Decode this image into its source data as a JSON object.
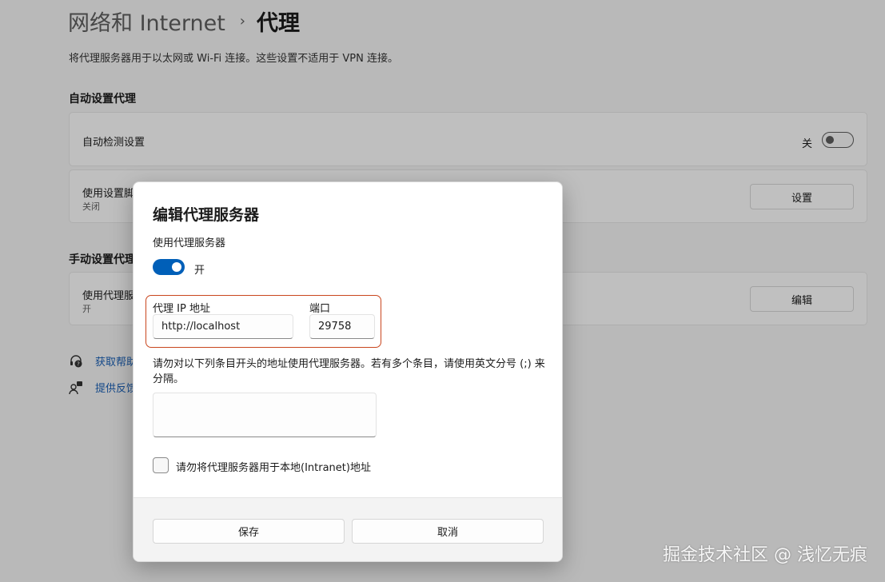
{
  "breadcrumb": {
    "parent": "网络和 Internet",
    "separator": "›",
    "current": "代理"
  },
  "page_description": "将代理服务器用于以太网或 Wi-Fi 连接。这些设置不适用于 VPN 连接。",
  "auto_section": {
    "title": "自动设置代理",
    "auto_detect": {
      "label": "自动检测设置",
      "state_label": "关",
      "enabled": false
    },
    "setup_script": {
      "label": "使用设置脚本",
      "sub": "关闭",
      "button": "设置"
    }
  },
  "manual_section": {
    "title": "手动设置代理",
    "use_proxy": {
      "label": "使用代理服务器",
      "sub": "开",
      "button": "编辑"
    }
  },
  "links": [
    {
      "label": "获取帮助",
      "icon": "help-headset-icon"
    },
    {
      "label": "提供反馈",
      "icon": "feedback-person-icon"
    }
  ],
  "dialog": {
    "title": "编辑代理服务器",
    "use_proxy_label": "使用代理服务器",
    "toggle_state": "开",
    "toggle_on": true,
    "ip_label": "代理 IP 地址",
    "ip_value": "http://localhost",
    "port_label": "端口",
    "port_value": "29758",
    "exceptions_label": "请勿对以下列条目开头的地址使用代理服务器。若有多个条目，请使用英文分号 (;) 来分隔。",
    "exceptions_value": "",
    "intranet_label": "请勿将代理服务器用于本地(Intranet)地址",
    "intranet_checked": false,
    "save_button": "保存",
    "cancel_button": "取消"
  },
  "watermark": "掘金技术社区 @ 浅忆无痕",
  "colors": {
    "accent": "#005fb8",
    "highlight_border": "#c9461e",
    "link": "#1a5fb4"
  }
}
